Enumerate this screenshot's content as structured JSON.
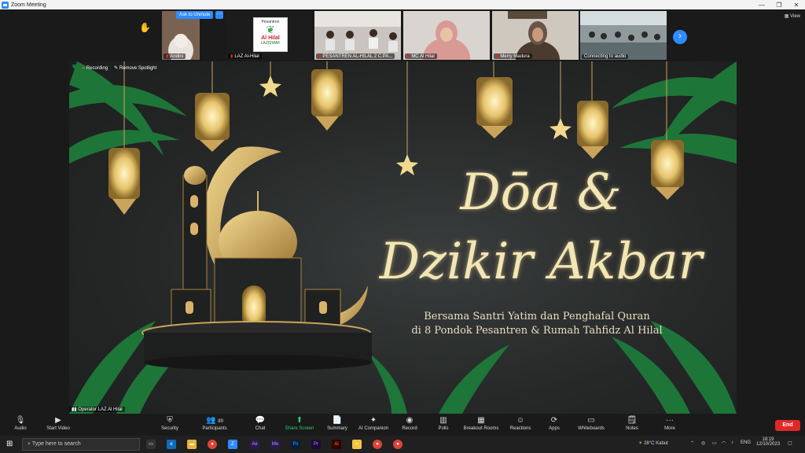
{
  "window": {
    "title": "Zoom Meeting"
  },
  "gallery": {
    "ask_unmute": "Ask to Unmute",
    "more": "···",
    "view": "View",
    "tiles": [
      {
        "name": "Andini"
      },
      {
        "name": "LAZ Al-Hilal"
      },
      {
        "name": "PESANTREN AL-HILAL 2 C.PA..."
      },
      {
        "name": "MC Al Hilal"
      },
      {
        "name": "Merry Madura"
      },
      {
        "name": "Connecting to audio"
      }
    ],
    "logo": {
      "top": "Pesantren",
      "main": "Al Hilal",
      "bottom": "LAZISWAF"
    }
  },
  "spotlight": {
    "recording": "Recording",
    "remove_spotlight": "Remove Spotlight",
    "operator": "Operator LAZ Al Hilal",
    "title_line1": "Dōa &",
    "title_line2": "Dzikir Akbar",
    "subtitle_line1": "Bersama Santri Yatim dan Penghafal Quran",
    "subtitle_line2": "di 8 Pondok Pesantren & Rumah Tahfidz Al Hilal"
  },
  "toolbar": {
    "audio": "Audio",
    "start_video": "Start Video",
    "security": "Security",
    "participants": "Participants",
    "participants_count": "89",
    "chat": "Chat",
    "share_screen": "Share Screen",
    "summary": "Summary",
    "ai_companion": "AI Companion",
    "record": "Record",
    "polls": "Polls",
    "breakout_rooms": "Breakout Rooms",
    "reactions": "Reactions",
    "apps": "Apps",
    "whiteboards": "Whiteboards",
    "notes": "Notes",
    "more": "More",
    "end": "End"
  },
  "taskbar": {
    "search_placeholder": "Type here to search",
    "weather": "28°C  Kabut",
    "lang": "ENG",
    "time": "18:19",
    "date": "12/10/2023"
  },
  "colors": {
    "zoom_blue": "#2d8cff",
    "end_red": "#e02828",
    "gold": "#d9b36a",
    "share_green": "#2ecc71"
  }
}
